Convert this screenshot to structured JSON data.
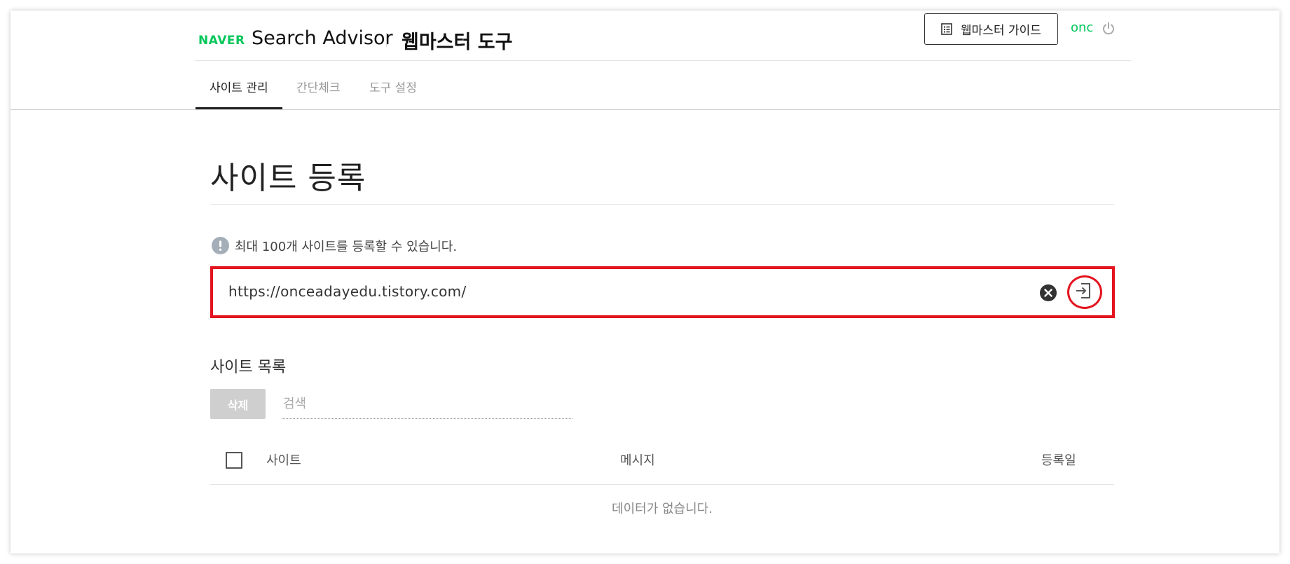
{
  "header": {
    "naver_logo": "NAVER",
    "title": "Search Advisor",
    "tool_title": "웹마스터 도구",
    "guide_button_label": "웹마스터 가이드",
    "user_name": "onc",
    "brand_color": "#03c75a"
  },
  "nav": {
    "tabs": [
      {
        "label": "사이트 관리",
        "active": true
      },
      {
        "label": "간단체크",
        "active": false
      },
      {
        "label": "도구 설정",
        "active": false
      }
    ]
  },
  "page": {
    "title": "사이트 등록",
    "notice": "최대 100개 사이트를 등록할 수 있습니다.",
    "url_input_value": "https://onceadayedu.tistory.com/",
    "highlight_color": "#e3141e"
  },
  "site_list": {
    "title": "사이트 목록",
    "delete_label": "삭제",
    "search_placeholder": "검색",
    "columns": [
      "사이트",
      "메시지",
      "등록일"
    ],
    "empty_message": "데이터가 없습니다."
  },
  "icons": {
    "guide": "document-list-icon",
    "power": "power-icon",
    "info": "exclamation-info-icon",
    "clear": "clear-x-icon",
    "submit": "enter-arrow-icon"
  }
}
